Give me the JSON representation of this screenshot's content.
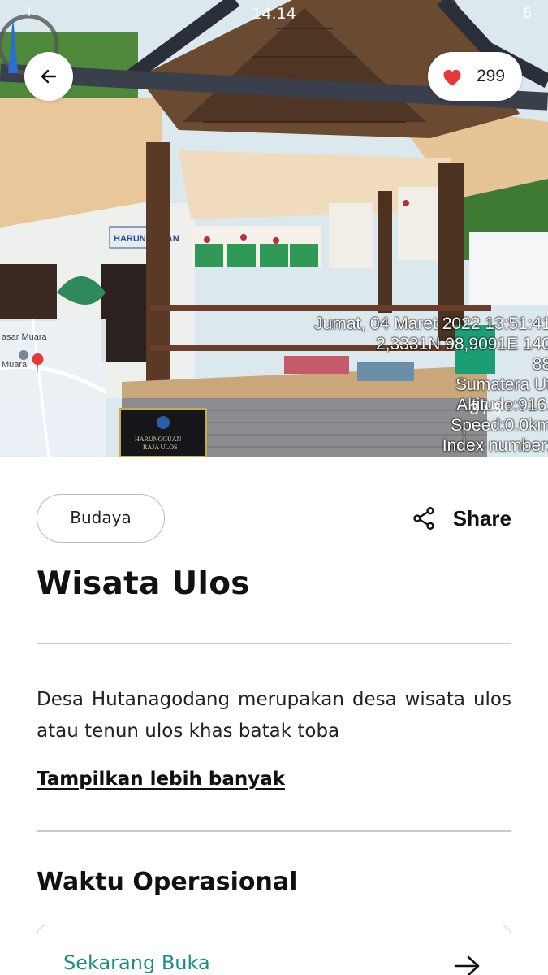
{
  "status_bar": {
    "time": "14.14",
    "left_info": "l",
    "battery": "6"
  },
  "hero": {
    "like_count": "299",
    "stamp_lines": [
      "Jumat, 04 Maret 2022 13:51:41",
      "2,3331N 98,9091E 140",
      "88",
      "Sumatera Ut",
      "Altitude:916.",
      "Speed:0.0km",
      "Index number:"
    ],
    "counter": "3 / 5",
    "map_labels": [
      "asar Muara",
      "Muara"
    ],
    "sign_lines": [
      "HARUNGGUAN",
      "RAJA ULOS"
    ],
    "mural_sign": "HARUNGGUAN"
  },
  "content": {
    "category_chip": "Budaya",
    "share_label": "Share",
    "title": "Wisata Ulos",
    "description": "Desa Hutanagodang merupakan desa wisata ulos atau tenun ulos khas batak toba",
    "show_more": "Tampilkan lebih banyak",
    "operational_title": "Waktu Operasional",
    "open_status": "Sekarang Buka"
  },
  "colors": {
    "accent_teal": "#1a8f84",
    "heart_red": "#e53935"
  },
  "icons": {
    "back": "arrow-left-icon",
    "like": "heart-icon",
    "share": "share-icon",
    "card": "arrow-right-icon"
  }
}
